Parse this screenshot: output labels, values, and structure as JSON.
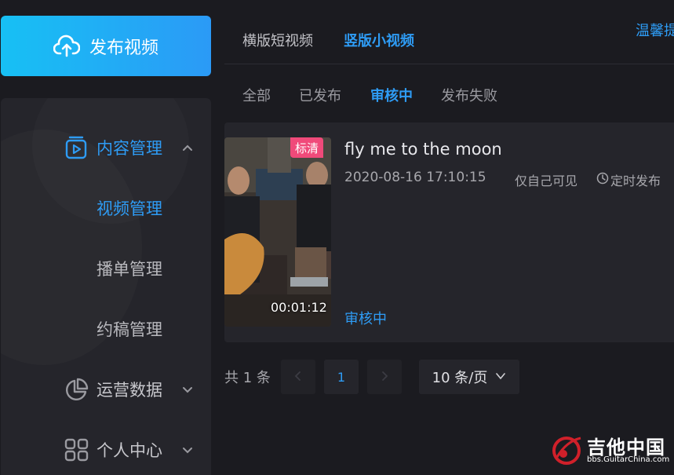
{
  "sidebar": {
    "publish_label": "发布视频",
    "groups": [
      {
        "label": "内容管理",
        "icon": "video-play-icon",
        "expanded": true
      },
      {
        "label": "运营数据",
        "icon": "pie-chart-icon"
      },
      {
        "label": "个人中心",
        "icon": "grid-icon"
      }
    ],
    "sub_items": [
      "视频管理",
      "播单管理",
      "约稿管理"
    ]
  },
  "header": {
    "tabs": [
      "横版短视频",
      "竖版小视频"
    ],
    "tip_label": "温馨提"
  },
  "filters": [
    "全部",
    "已发布",
    "审核中",
    "发布失败"
  ],
  "video": {
    "quality": "标清",
    "duration": "00:01:12",
    "title": "fly me to the moon",
    "date": "2020-08-16 17:10:15",
    "privacy": "仅自己可见",
    "scheduled": "定时发布",
    "status": "审核中"
  },
  "pagination": {
    "total": "共 1 条",
    "current_page": "1",
    "page_size": "10 条/页"
  },
  "watermark": {
    "title": "吉他中国",
    "url": "bbs.GuitarChina.com"
  },
  "colors": {
    "accent": "#2e9cf5",
    "background": "#1b1b20",
    "panel": "#25252b",
    "tag": "#f04a7a"
  }
}
